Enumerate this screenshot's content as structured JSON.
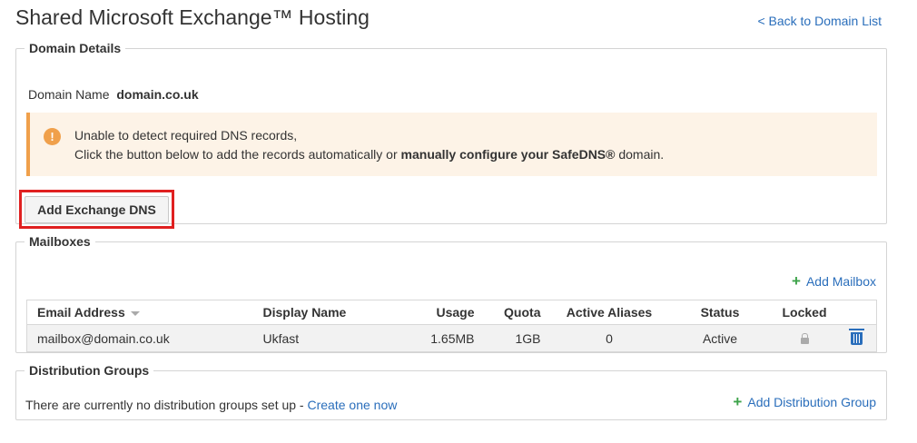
{
  "page": {
    "title": "Shared Microsoft Exchange™ Hosting",
    "back_link": "< Back to Domain List"
  },
  "domain_details": {
    "legend": "Domain Details",
    "domain_name_label": "Domain Name",
    "domain_name_value": "domain.co.uk",
    "alert": {
      "icon": "!",
      "line1": "Unable to detect required DNS records,",
      "line2_prefix": "Click the button below to add the records automatically or",
      "line2_bold": "manually configure your SafeDNS®",
      "line2_suffix": "domain."
    },
    "add_dns_button": "Add Exchange DNS"
  },
  "mailboxes": {
    "legend": "Mailboxes",
    "add_label": "Add Mailbox",
    "columns": [
      "Email Address",
      "Display Name",
      "Usage",
      "Quota",
      "Active Aliases",
      "Status",
      "Locked"
    ],
    "rows": [
      {
        "email": "mailbox@domain.co.uk",
        "display_name": "Ukfast",
        "usage": "1.65MB",
        "quota": "1GB",
        "aliases": "0",
        "status": "Active"
      }
    ]
  },
  "distribution_groups": {
    "legend": "Distribution Groups",
    "empty_text": "There are currently no distribution groups set up -",
    "create_link": "Create one now",
    "add_label": "Add Distribution Group"
  },
  "colors": {
    "link": "#2a6ebb",
    "alert_accent": "#f0a04b",
    "alert_bg": "#fdf3e7",
    "add_plus": "#3da34a",
    "highlight": "#e02020"
  }
}
